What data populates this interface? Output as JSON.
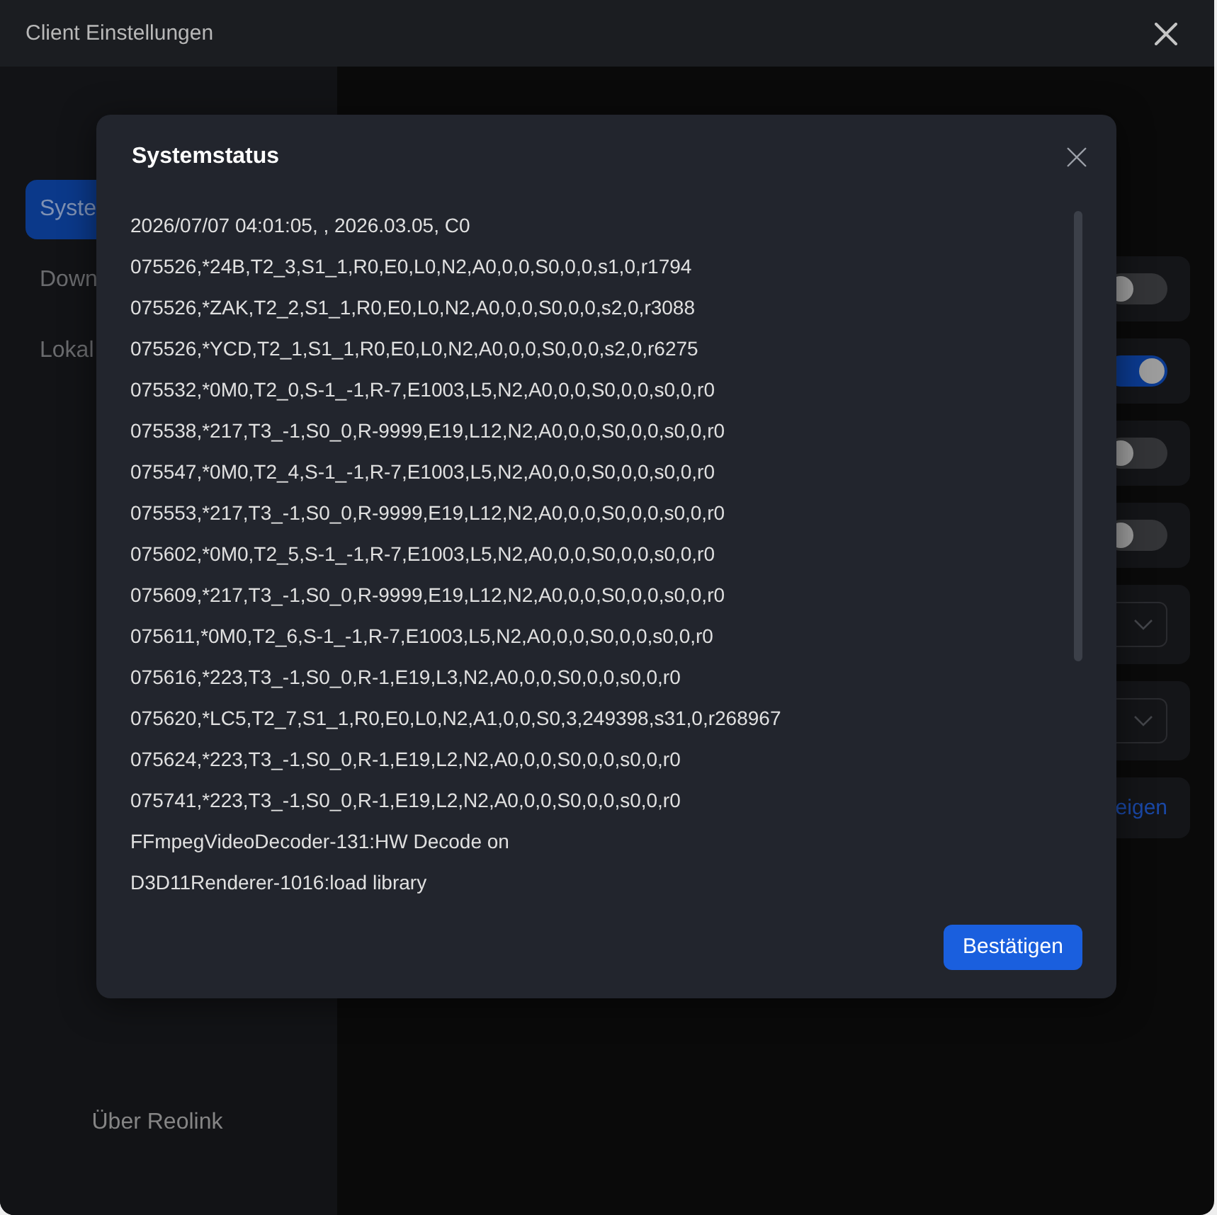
{
  "window": {
    "title": "Client Einstellungen"
  },
  "sidebar": {
    "items": [
      {
        "label": "Syste",
        "selected": true
      },
      {
        "label": "Down",
        "selected": false
      },
      {
        "label": "Lokal",
        "selected": false
      }
    ],
    "footer": "Über Reolink"
  },
  "main": {
    "settings": [
      {
        "kind": "toggle",
        "on": false
      },
      {
        "kind": "toggle",
        "on": true
      },
      {
        "kind": "toggle",
        "on": false
      },
      {
        "kind": "toggle",
        "on": false
      },
      {
        "kind": "dropdown"
      },
      {
        "kind": "dropdown"
      },
      {
        "kind": "link",
        "label": "eigen"
      }
    ]
  },
  "dialog": {
    "title": "Systemstatus",
    "lines": [
      "2026/07/07 04:01:05, , 2026.03.05, C0",
      "075526,*24B,T2_3,S1_1,R0,E0,L0,N2,A0,0,0,S0,0,0,s1,0,r1794",
      "075526,*ZAK,T2_2,S1_1,R0,E0,L0,N2,A0,0,0,S0,0,0,s2,0,r3088",
      "075526,*YCD,T2_1,S1_1,R0,E0,L0,N2,A0,0,0,S0,0,0,s2,0,r6275",
      "075532,*0M0,T2_0,S-1_-1,R-7,E1003,L5,N2,A0,0,0,S0,0,0,s0,0,r0",
      "075538,*217,T3_-1,S0_0,R-9999,E19,L12,N2,A0,0,0,S0,0,0,s0,0,r0",
      "075547,*0M0,T2_4,S-1_-1,R-7,E1003,L5,N2,A0,0,0,S0,0,0,s0,0,r0",
      "075553,*217,T3_-1,S0_0,R-9999,E19,L12,N2,A0,0,0,S0,0,0,s0,0,r0",
      "075602,*0M0,T2_5,S-1_-1,R-7,E1003,L5,N2,A0,0,0,S0,0,0,s0,0,r0",
      "075609,*217,T3_-1,S0_0,R-9999,E19,L12,N2,A0,0,0,S0,0,0,s0,0,r0",
      "075611,*0M0,T2_6,S-1_-1,R-7,E1003,L5,N2,A0,0,0,S0,0,0,s0,0,r0",
      "075616,*223,T3_-1,S0_0,R-1,E19,L3,N2,A0,0,0,S0,0,0,s0,0,r0",
      "075620,*LC5,T2_7,S1_1,R0,E0,L0,N2,A1,0,0,S0,3,249398,s31,0,r268967",
      "075624,*223,T3_-1,S0_0,R-1,E19,L2,N2,A0,0,0,S0,0,0,s0,0,r0",
      "075741,*223,T3_-1,S0_0,R-1,E19,L2,N2,A0,0,0,S0,0,0,s0,0,r0",
      "FFmpegVideoDecoder-131:HW Decode on",
      "D3D11Renderer-1016:load library"
    ],
    "confirm": "Bestätigen"
  }
}
